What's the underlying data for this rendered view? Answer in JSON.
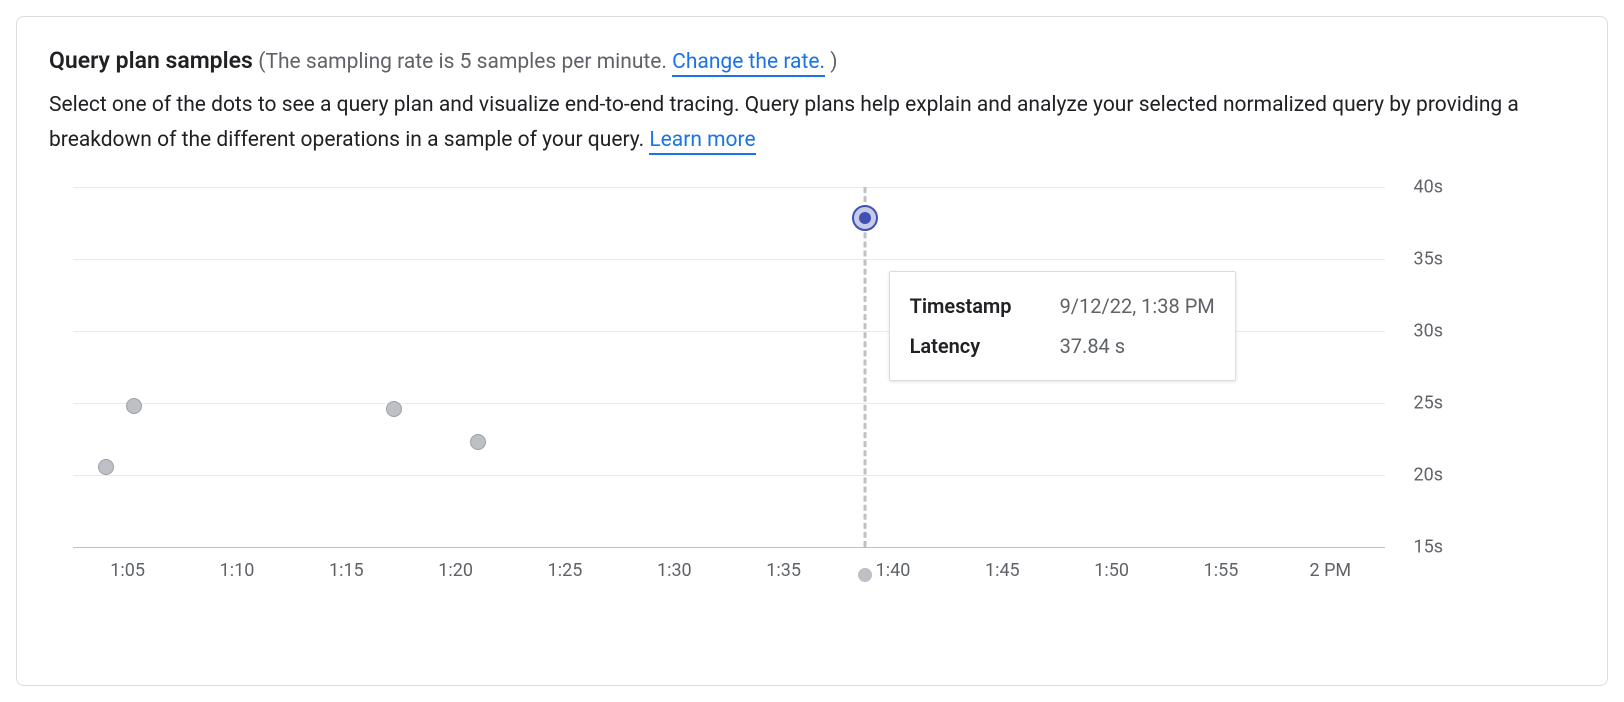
{
  "header": {
    "title": "Query plan samples",
    "sampling_prefix": "(The sampling rate is 5 samples per minute.",
    "change_rate_label": "Change the rate.",
    "sampling_suffix": ")"
  },
  "description": {
    "text_part1": "Select one of the dots to see a query plan and visualize end-to-end tracing. Query plans help explain and analyze your selected normalized query by providing a breakdown of the different operations in a sample of your query. ",
    "learn_more_label": "Learn more"
  },
  "tooltip": {
    "timestamp_label": "Timestamp",
    "timestamp_value": "9/12/22, 1:38 PM",
    "latency_label": "Latency",
    "latency_value": "37.84 s"
  },
  "chart_data": {
    "type": "scatter",
    "title": "",
    "xlabel": "",
    "ylabel": "",
    "y_ticks": [
      "40s",
      "35s",
      "30s",
      "25s",
      "20s",
      "15s"
    ],
    "y_range": [
      15,
      40
    ],
    "x_ticks": [
      "1:05",
      "1:10",
      "1:15",
      "1:20",
      "1:25",
      "1:30",
      "1:35",
      "1:40",
      "1:45",
      "1:50",
      "1:55",
      "2 PM"
    ],
    "x_range_minutes": [
      62.5,
      122.5
    ],
    "series": [
      {
        "name": "samples",
        "points": [
          {
            "x_minute": 64.0,
            "y": 20.6,
            "selected": false
          },
          {
            "x_minute": 65.3,
            "y": 24.8,
            "selected": false
          },
          {
            "x_minute": 77.2,
            "y": 24.6,
            "selected": false
          },
          {
            "x_minute": 81.0,
            "y": 22.3,
            "selected": false
          },
          {
            "x_minute": 98.7,
            "y": 37.84,
            "selected": true
          }
        ]
      }
    ],
    "hover_x_minute": 98.7
  }
}
